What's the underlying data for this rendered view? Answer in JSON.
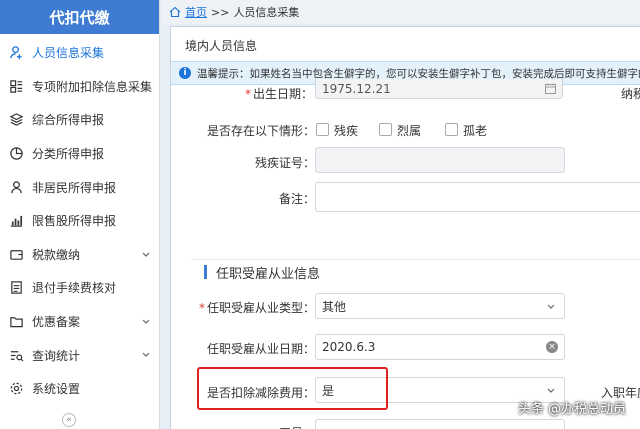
{
  "sidebar": {
    "brand": "代扣代缴",
    "items": [
      {
        "label": "人员信息采集",
        "icon": "user-add-icon"
      },
      {
        "label": "专项附加扣除信息采集",
        "icon": "grid-icon"
      },
      {
        "label": "综合所得申报",
        "icon": "layers-icon"
      },
      {
        "label": "分类所得申报",
        "icon": "pie-chart-icon"
      },
      {
        "label": "非居民所得申报",
        "icon": "person-icon"
      },
      {
        "label": "限售股所得申报",
        "icon": "bar-chart-icon"
      },
      {
        "label": "税款缴纳",
        "icon": "wallet-icon"
      },
      {
        "label": "退付手续费核对",
        "icon": "document-icon"
      },
      {
        "label": "优惠备案",
        "icon": "folder-icon"
      },
      {
        "label": "查询统计",
        "icon": "query-list-icon"
      },
      {
        "label": "系统设置",
        "icon": "gear-icon"
      }
    ],
    "collapse_label": "«"
  },
  "breadcrumb": {
    "home": "首页",
    "separator": ">>",
    "current": "人员信息采集"
  },
  "panel": {
    "title": "境内人员信息",
    "tip": "温馨提示：如果姓名当中包含生僻字的，您可以安装生僻字补丁包，安装完成后即可支持生僻字的录入"
  },
  "form": {
    "birth_date_label": "出生日期：",
    "birth_date_value": "1975.12.21",
    "taxpayer_partial_label": "纳税",
    "situation_label": "是否存在以下情形：",
    "situation_options": [
      "残疾",
      "烈属",
      "孤老"
    ],
    "disability_cert_label": "残疾证号：",
    "remarks_label": "备注：",
    "section_title": "任职受雇从业信息",
    "employment_type_label": "任职受雇从业类型：",
    "employment_type_value": "其他",
    "employment_date_label": "任职受雇从业日期：",
    "employment_date_value": "2020.6.3",
    "deduct_expense_label": "是否扣除减除费用：",
    "deduct_expense_value": "是",
    "entry_year_partial_label": "入职年度",
    "employee_no_partial_label": "工号"
  },
  "watermark": "头条 @办税总动员",
  "colors": {
    "accent": "#3d7cd2",
    "link": "#1a73d9",
    "highlight": "#e02020",
    "required": "#e03c31"
  }
}
